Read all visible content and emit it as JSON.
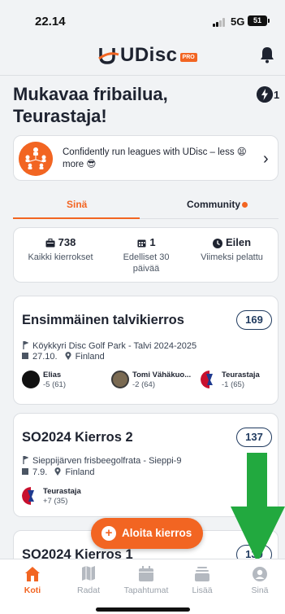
{
  "status_bar": {
    "time": "22.14",
    "network": "5G",
    "battery": "51"
  },
  "app": {
    "logo_text": "UDisc",
    "pro_badge": "PRO"
  },
  "header": {
    "greeting": "Mukavaa fribailua, Teurastaja!",
    "bolt_count": "1"
  },
  "promo": {
    "text": "Confidently run leagues with UDisc – less 😫 more 😎"
  },
  "tabs": [
    {
      "label": "Sinä",
      "active": true
    },
    {
      "label": "Community",
      "has_dot": true
    }
  ],
  "stats": [
    {
      "icon": "suitcase-icon",
      "value": "738",
      "label": "Kaikki kierrokset"
    },
    {
      "icon": "calendar-icon",
      "value": "1",
      "label": "Edelliset 30 päivää"
    },
    {
      "icon": "clock-icon",
      "value": "Eilen",
      "label": "Viimeksi pelattu"
    }
  ],
  "rounds": [
    {
      "title": "Ensimmäinen talvikierros",
      "score": "169",
      "course": "Köykkyri Disc Golf Park - Talvi 2024-2025",
      "date": "27.10.",
      "location": "Finland",
      "players": [
        {
          "name": "Elias",
          "score": "-5 (61)"
        },
        {
          "name": "Tomi Vähäkuo...",
          "score": "-2 (64)"
        },
        {
          "name": "Teurastaja",
          "score": "-1 (65)"
        }
      ]
    },
    {
      "title": "SO2024 Kierros 2",
      "score": "137",
      "course": "Sieppijärven frisbeegolfrata - Sieppi-9",
      "date": "7.9.",
      "location": "Finland",
      "players": [
        {
          "name": "Teurastaja",
          "score": "+7 (35)"
        }
      ]
    },
    {
      "title": "SO2024 Kierros 1",
      "score": "130"
    }
  ],
  "start_button": {
    "label": "Aloita kierros"
  },
  "nav": [
    {
      "label": "Koti",
      "icon": "home-icon",
      "active": true
    },
    {
      "label": "Radat",
      "icon": "courses-icon"
    },
    {
      "label": "Tapahtumat",
      "icon": "events-icon"
    },
    {
      "label": "Lisää",
      "icon": "more-icon"
    },
    {
      "label": "Sinä",
      "icon": "profile-icon"
    }
  ],
  "colors": {
    "accent": "#f26522",
    "score_border": "#1f3a5f",
    "arrow": "#22a93f"
  }
}
